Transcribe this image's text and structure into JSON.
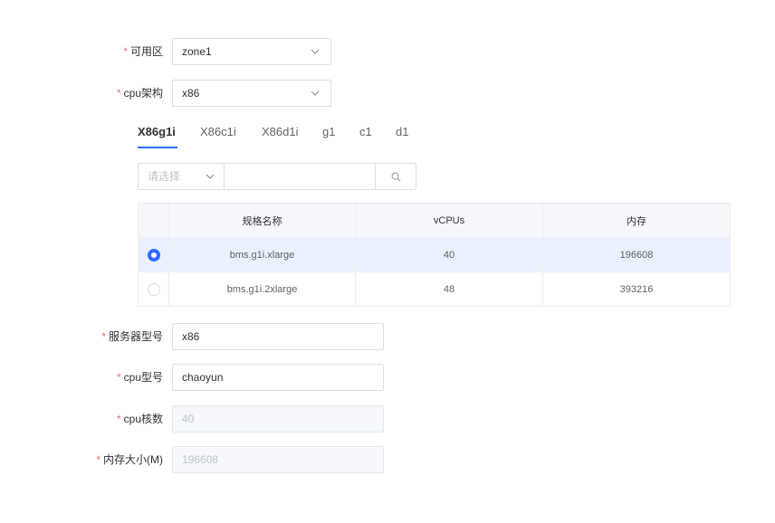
{
  "form": {
    "zone": {
      "label": "可用区",
      "value": "zone1"
    },
    "arch": {
      "label": "cpu架构",
      "value": "x86"
    },
    "server_model": {
      "label": "服务器型号",
      "value": "x86"
    },
    "cpu_model": {
      "label": "cpu型号",
      "value": "chaoyun"
    },
    "cpu_cores": {
      "label": "cpu核数",
      "value": "40"
    },
    "memory": {
      "label": "内存大小(M)",
      "value": "196608"
    },
    "required_mark": "*"
  },
  "tabs": [
    "X86g1i",
    "X86c1i",
    "X86d1i",
    "g1",
    "c1",
    "d1"
  ],
  "active_tab": "X86g1i",
  "filter": {
    "select_placeholder": "请选择",
    "search_value": ""
  },
  "table": {
    "headers": [
      "规格名称",
      "vCPUs",
      "内存"
    ],
    "rows": [
      {
        "name": "bms.g1i.xlarge",
        "vcpus": "40",
        "memory": "196608",
        "selected": true
      },
      {
        "name": "bms.g1i.2xlarge",
        "vcpus": "48",
        "memory": "393216",
        "selected": false
      }
    ]
  },
  "colors": {
    "accent": "#2f6bff",
    "required": "#f56c6c",
    "selected_row": "#eaf0fd"
  }
}
